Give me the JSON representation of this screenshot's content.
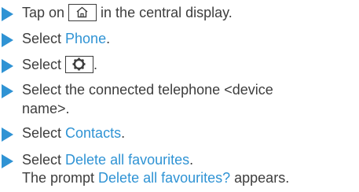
{
  "colors": {
    "accent": "#2f93d4",
    "text": "#3d3d3d"
  },
  "steps": [
    {
      "before": "Tap on ",
      "icon": "home-icon",
      "after": " in the central display."
    },
    {
      "before": "Select ",
      "link": "Phone",
      "after": "."
    },
    {
      "before": "Select ",
      "icon": "gear-icon",
      "after": "."
    },
    {
      "line1": "Select the connected telephone <device",
      "line2": "name>."
    },
    {
      "before": "Select ",
      "link": "Contacts",
      "after": "."
    },
    {
      "before": "Select ",
      "link": "Delete all favourites",
      "after": ".",
      "result_before": "The prompt ",
      "result_link": "Delete all favourites?",
      "result_after": " appears."
    }
  ]
}
